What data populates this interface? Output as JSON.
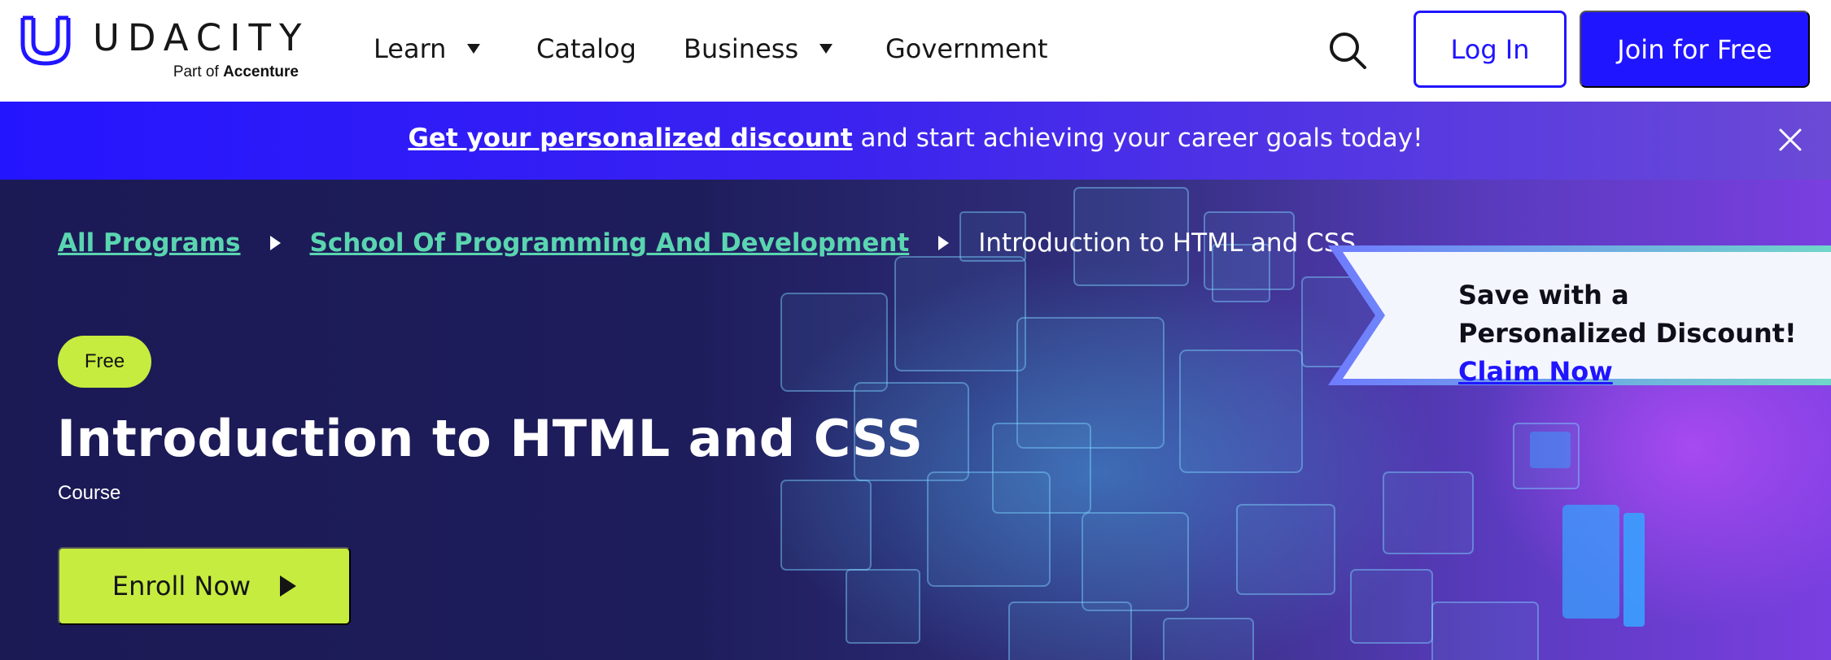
{
  "brand": {
    "name": "UDACITY",
    "tagline_prefix": "Part of",
    "tagline_company": "Accenture",
    "color": "#2015ff"
  },
  "nav": {
    "items": [
      {
        "label": "Learn",
        "has_dropdown": true
      },
      {
        "label": "Catalog",
        "has_dropdown": false
      },
      {
        "label": "Business",
        "has_dropdown": true
      },
      {
        "label": "Government",
        "has_dropdown": false
      }
    ],
    "search_icon": "search-icon",
    "login_label": "Log In",
    "join_label": "Join for Free"
  },
  "promo": {
    "link_text": "Get your personalized discount",
    "rest_text": " and start achieving your career goals today!",
    "close_icon": "close-icon",
    "color_start": "#2415ff",
    "color_end": "#6b4ad6"
  },
  "breadcrumb": {
    "items": [
      "All Programs",
      "School Of Programming And Development"
    ],
    "current": "Introduction to HTML and CSS",
    "link_color": "#5ad5b0"
  },
  "hero": {
    "badge": "Free",
    "title": "Introduction to HTML and CSS",
    "type": "Course",
    "enroll_label": "Enroll Now",
    "enroll_icon": "play-icon",
    "accent": "#c6ec3f",
    "background": "#1b1a55"
  },
  "discount_ribbon": {
    "text": "Save with a Personalized Discount! ",
    "link": "Claim Now"
  }
}
